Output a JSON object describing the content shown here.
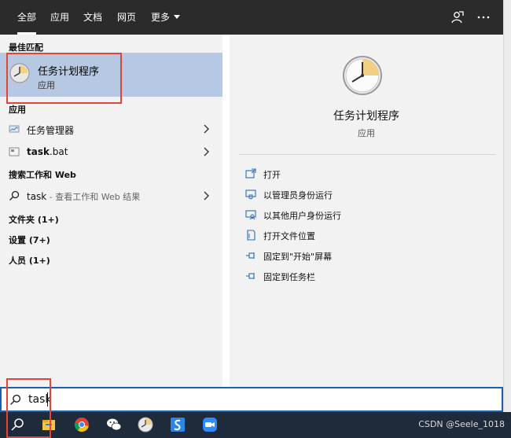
{
  "tabs": [
    {
      "label": "全部",
      "active": true
    },
    {
      "label": "应用"
    },
    {
      "label": "文档"
    },
    {
      "label": "网页"
    },
    {
      "label": "更多"
    }
  ],
  "best_match": {
    "header": "最佳匹配",
    "title": "任务计划程序",
    "subtitle": "应用"
  },
  "apps": {
    "header": "应用",
    "items": [
      {
        "label": "任务管理器"
      },
      {
        "label_bold": "task",
        "label_rest": ".bat"
      }
    ]
  },
  "web": {
    "header": "搜索工作和 Web",
    "query": "task",
    "hint": " - 查看工作和 Web 结果"
  },
  "categories": [
    {
      "label": "文件夹 (1+)"
    },
    {
      "label": "设置 (7+)"
    },
    {
      "label": "人员 (1+)"
    }
  ],
  "preview": {
    "title": "任务计划程序",
    "subtitle": "应用",
    "actions": [
      {
        "label": "打开",
        "icon": "open-icon"
      },
      {
        "label": "以管理员身份运行",
        "icon": "shield-icon"
      },
      {
        "label": "以其他用户身份运行",
        "icon": "user-icon"
      },
      {
        "label": "打开文件位置",
        "icon": "file-location-icon"
      },
      {
        "label": "固定到\"开始\"屏幕",
        "icon": "pin-icon"
      },
      {
        "label": "固定到任务栏",
        "icon": "pin-icon"
      }
    ]
  },
  "search": {
    "value": "task"
  },
  "taskbar": {
    "apps": [
      "search-icon",
      "file-explorer-icon",
      "chrome-icon",
      "wechat-icon",
      "task-scheduler-icon",
      "sogou-icon",
      "zoom-icon"
    ],
    "watermark": "CSDN @Seele_1018"
  },
  "colors": {
    "topbar": "#2b2b2b",
    "highlight": "#b7c9e2",
    "search_border": "#1a5fb4",
    "annotation": "#e0453c",
    "taskbar": "#1f2a3a"
  }
}
